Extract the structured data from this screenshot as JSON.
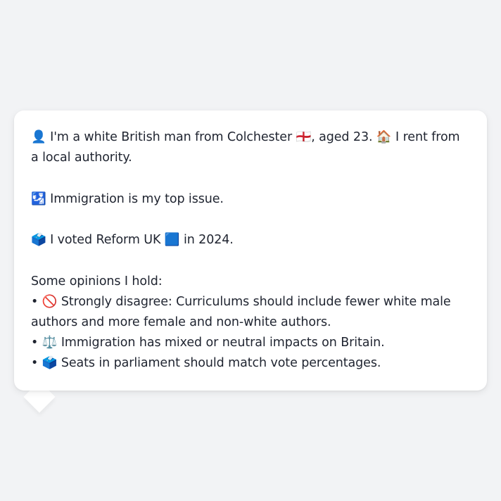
{
  "message": {
    "intro": "👤 I'm a white British man from Colchester 🏴󠁧󠁢󠁥󠁮󠁧󠁿, aged 23. 🏠 I rent from a local authority.",
    "top_issue": "🛂 Immigration is my top issue.",
    "vote": "🗳️ I voted Reform UK 🟦 in 2024.",
    "opinions_heading": "Some opinions I hold:",
    "opinions": [
      "• 🚫 Strongly disagree: Curriculums should include fewer white male authors and more female and non-white authors.",
      "• ⚖️ Immigration has mixed or neutral impacts on Britain.",
      "• 🗳️ Seats in parliament should match vote percentages."
    ]
  }
}
